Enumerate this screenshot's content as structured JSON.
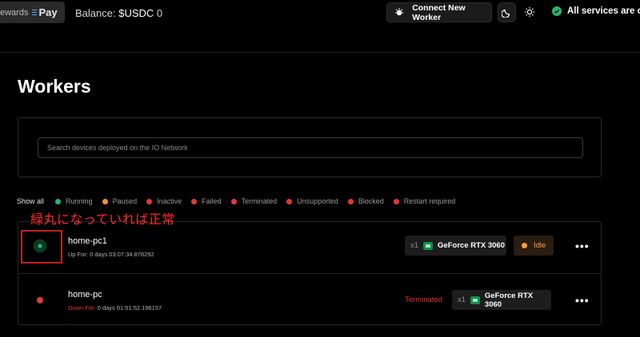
{
  "header": {
    "rewards_label": "ewards",
    "pay_label": "Pay",
    "balance_label": "Balance:",
    "balance_currency": "$USDC",
    "balance_value": "0",
    "connect_label": "Connect New Worker",
    "status_text": "All services are onli"
  },
  "page": {
    "title": "Workers",
    "search_placeholder": "Search devices deployed on the IO Network"
  },
  "filters": {
    "all_label": "Show all",
    "items": [
      {
        "label": "Running",
        "color": "#2db36f"
      },
      {
        "label": "Paused",
        "color": "#f0913a"
      },
      {
        "label": "Inactive",
        "color": "#e53935"
      },
      {
        "label": "Failed",
        "color": "#e53935"
      },
      {
        "label": "Terminated",
        "color": "#e53935"
      },
      {
        "label": "Unsupported",
        "color": "#e53935"
      },
      {
        "label": "Blocked",
        "color": "#e53935"
      },
      {
        "label": "Restart required",
        "color": "#e53935"
      }
    ]
  },
  "annotation": {
    "text": "緑丸になっていれば正常",
    "color": "#ff2a2a"
  },
  "workers": [
    {
      "name": "home-pc1",
      "time_label": "Up For:",
      "time_value": "0 days 03:07:34.878292",
      "indicator_color": "#2db36f",
      "gpu_count": "x1",
      "gpu_name": "GeForce RTX 3060",
      "status": "Idle"
    },
    {
      "name": "home-pc",
      "time_label": "Down For:",
      "time_value": "0 days 01:51:52.196157",
      "indicator_color": "#e53935",
      "gpu_count": "x1",
      "gpu_name": "GeForce RTX 3060",
      "status": "Terminated"
    }
  ],
  "more_label": "•••",
  "colors": {
    "running": "#2db36f",
    "idle": "#ff9b3d",
    "terminated": "#e53935"
  }
}
